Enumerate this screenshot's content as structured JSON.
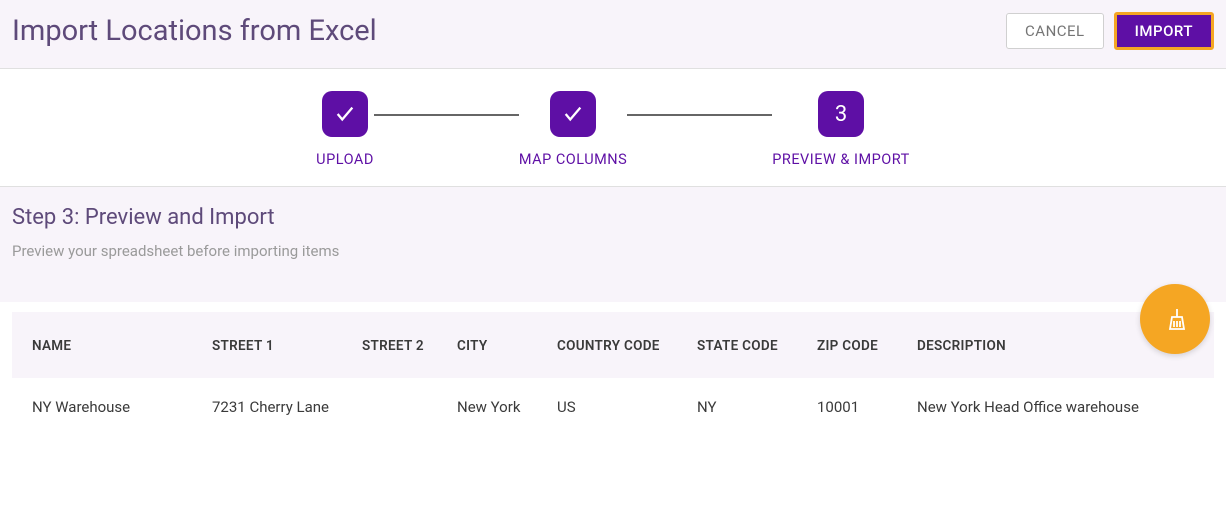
{
  "header": {
    "title": "Import Locations from Excel",
    "cancel_label": "CANCEL",
    "import_label": "IMPORT"
  },
  "stepper": {
    "steps": [
      {
        "label": "UPLOAD",
        "indicator": "check"
      },
      {
        "label": "MAP COLUMNS",
        "indicator": "check"
      },
      {
        "label": "PREVIEW & IMPORT",
        "indicator": "3"
      }
    ],
    "current_step_index": 2
  },
  "section": {
    "title": "Step 3: Preview and Import",
    "subtitle": "Preview your spreadsheet before importing items"
  },
  "table": {
    "columns": [
      "NAME",
      "STREET 1",
      "STREET 2",
      "CITY",
      "COUNTRY CODE",
      "STATE CODE",
      "ZIP CODE",
      "DESCRIPTION"
    ],
    "rows": [
      {
        "name": "NY Warehouse",
        "street1": "7231 Cherry Lane",
        "street2": "",
        "city": "New York",
        "country_code": "US",
        "state_code": "NY",
        "zip_code": "10001",
        "description": "New York Head Office warehouse"
      }
    ]
  },
  "fab_icon": "broom-icon",
  "colors": {
    "primary": "#5e0fa5",
    "accent": "#f5a623",
    "muted_bg": "#f8f4fa"
  }
}
